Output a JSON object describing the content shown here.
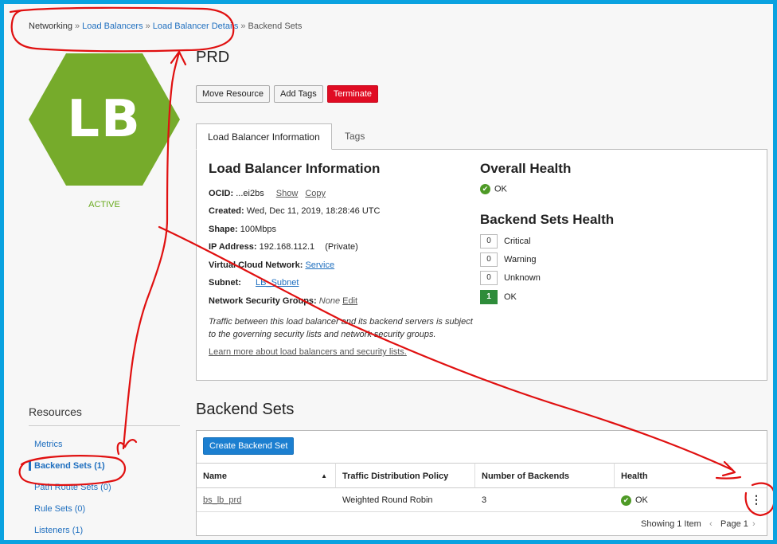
{
  "breadcrumb": {
    "items": [
      "Networking",
      "Load Balancers",
      "Load Balancer Details"
    ],
    "current": "Backend Sets"
  },
  "resource": {
    "badge": "LB",
    "status": "ACTIVE",
    "title": "PRD",
    "color": "#76ab2b"
  },
  "actions": {
    "move": "Move Resource",
    "tags": "Add Tags",
    "terminate": "Terminate"
  },
  "tabs": {
    "info": "Load Balancer Information",
    "tags": "Tags"
  },
  "info": {
    "heading": "Load Balancer Information",
    "ocid_label": "OCID:",
    "ocid_value": "...ei2bs",
    "show": "Show",
    "copy": "Copy",
    "created_label": "Created:",
    "created_value": "Wed, Dec 11, 2019, 18:28:46 UTC",
    "shape_label": "Shape:",
    "shape_value": "100Mbps",
    "ip_label": "IP Address:",
    "ip_value": "192.168.112.1",
    "ip_type": "(Private)",
    "vcn_label": "Virtual Cloud Network:",
    "vcn_value": "Service",
    "subnet_label": "Subnet:",
    "subnet_value": "LB_Subnet",
    "nsg_label": "Network Security Groups:",
    "nsg_value": "None",
    "nsg_edit": "Edit",
    "note": "Traffic between this load balancer and its backend servers is subject to the governing security lists and network security groups.",
    "learn_more": "Learn more about load balancers and security lists."
  },
  "health": {
    "overall_heading": "Overall Health",
    "overall_value": "OK",
    "sets_heading": "Backend Sets Health",
    "counts": [
      {
        "count": "0",
        "label": "Critical"
      },
      {
        "count": "0",
        "label": "Warning"
      },
      {
        "count": "0",
        "label": "Unknown"
      },
      {
        "count": "1",
        "label": "OK"
      }
    ]
  },
  "resources": {
    "title": "Resources",
    "items": [
      {
        "label": "Metrics"
      },
      {
        "label": "Backend Sets (1)"
      },
      {
        "label": "Path Route Sets (0)"
      },
      {
        "label": "Rule Sets (0)"
      },
      {
        "label": "Listeners (1)"
      }
    ]
  },
  "backend_sets": {
    "title": "Backend Sets",
    "create": "Create Backend Set",
    "columns": [
      "Name",
      "Traffic Distribution Policy",
      "Number of Backends",
      "Health"
    ],
    "rows": [
      {
        "name": "bs_lb_prd",
        "policy": "Weighted Round Robin",
        "backends": "3",
        "health": "OK"
      }
    ],
    "showing": "Showing 1 Item",
    "page": "Page 1"
  }
}
